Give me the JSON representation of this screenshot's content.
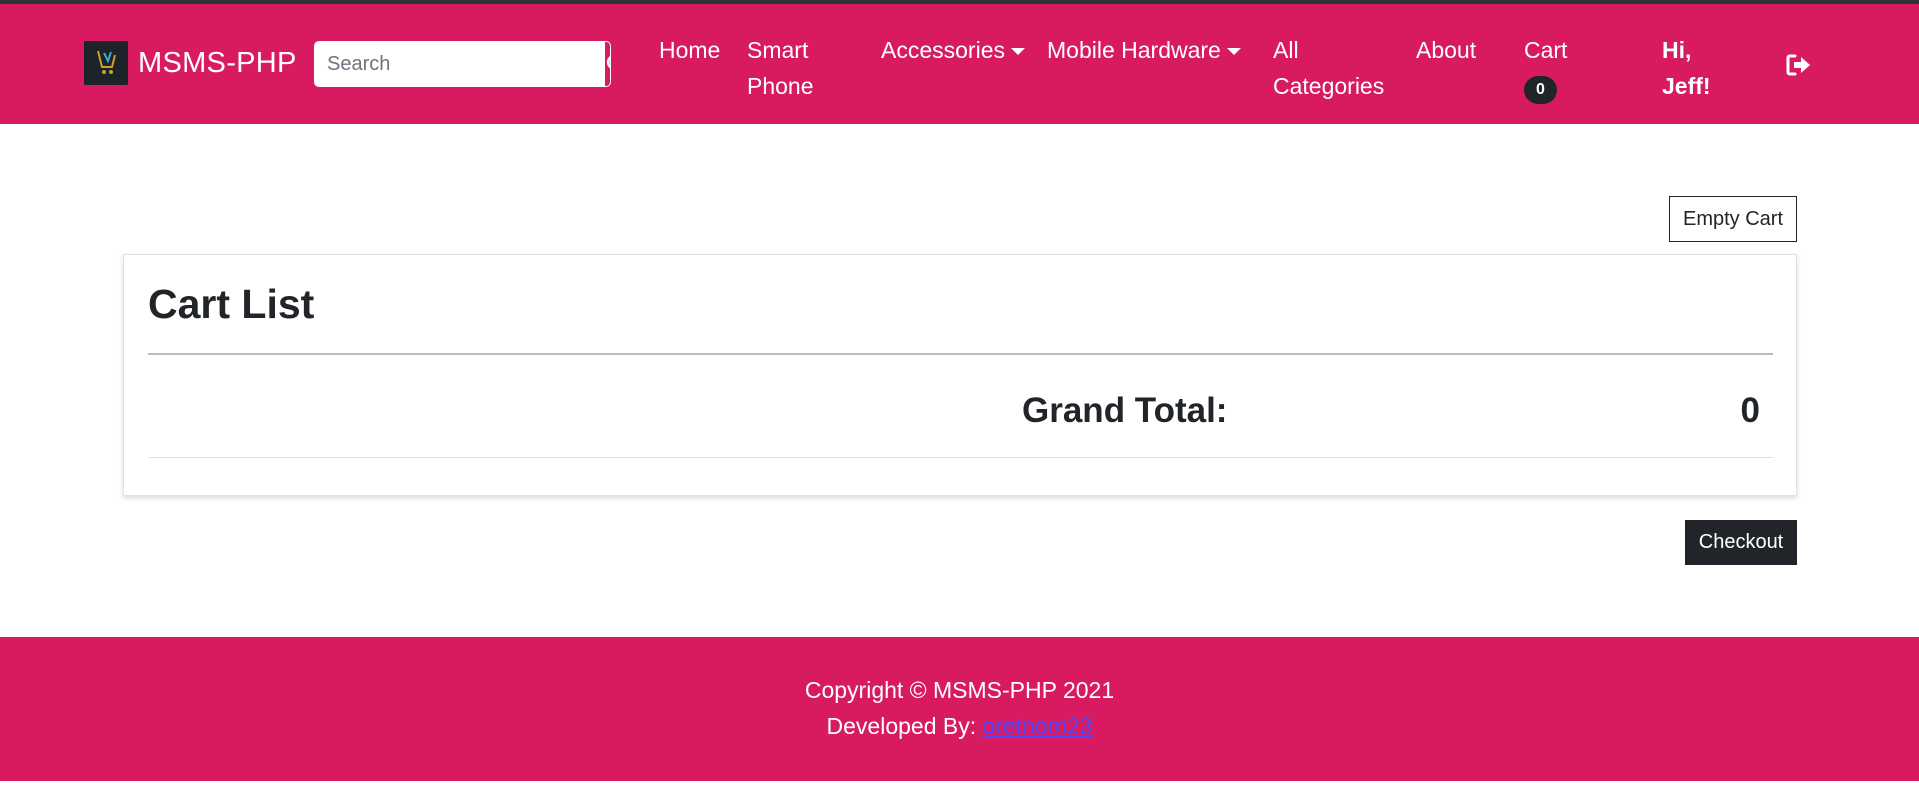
{
  "navbar": {
    "brand": "MSMS-PHP",
    "search_placeholder": "Search",
    "items": {
      "home": "Home",
      "smart_phone_l1": "Smart",
      "smart_phone_l2": "Phone",
      "accessories": "Accessories",
      "mobile_hardware": "Mobile Hardware",
      "all_categories_l1": "All",
      "all_categories_l2": "Categories",
      "about": "About",
      "cart": "Cart",
      "cart_count": "0"
    },
    "greeting_l1": "Hi,",
    "greeting_l2": "Jeff!",
    "icons": [
      "search-icon",
      "logout-icon",
      "caret-down-icon"
    ]
  },
  "cart": {
    "empty_cart_label": "Empty Cart",
    "title": "Cart List",
    "grand_total_label": "Grand Total:",
    "grand_total_value": "0",
    "checkout_label": "Checkout"
  },
  "footer": {
    "copyright": "Copyright © MSMS-PHP 2021",
    "developed_by": "Developed By:",
    "developer_link": "oretnom23"
  },
  "colors": {
    "primary": "#d81b60",
    "dark": "#212529",
    "link": "#4a49ff"
  }
}
